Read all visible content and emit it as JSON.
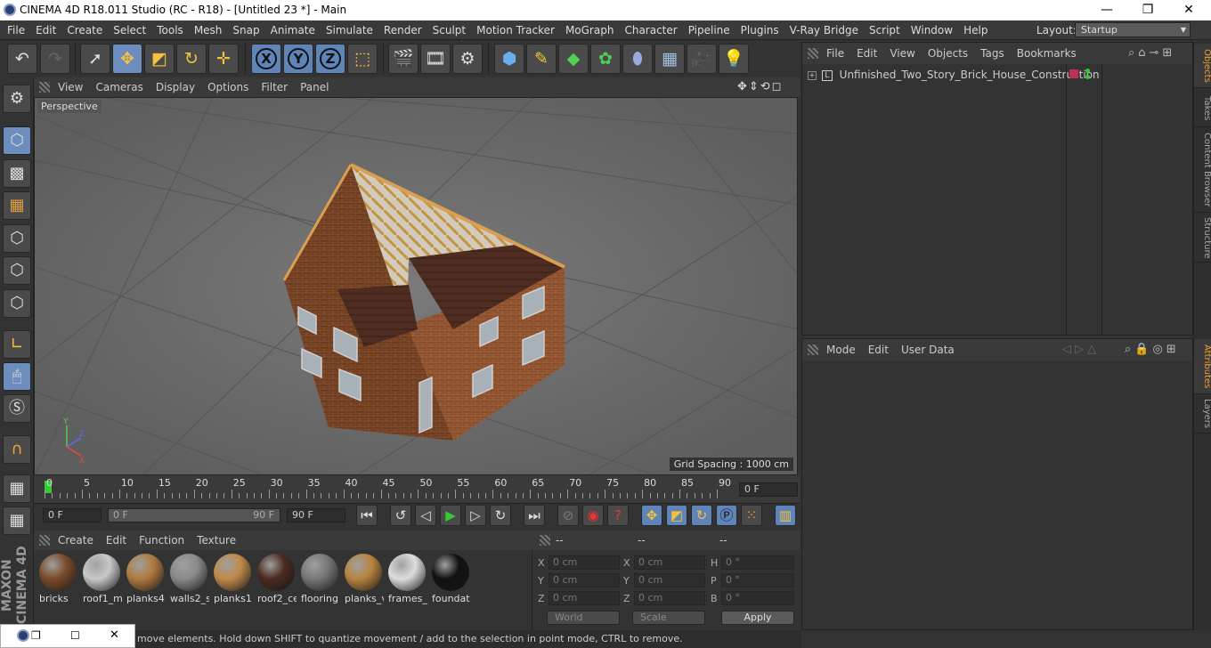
{
  "window": {
    "title": "CINEMA 4D R18.011 Studio (RC - R18) - [Untitled 23 *] - Main",
    "minimize": "—",
    "maximize": "❐",
    "close": "✕"
  },
  "menubar": [
    "File",
    "Edit",
    "Create",
    "Select",
    "Tools",
    "Mesh",
    "Snap",
    "Animate",
    "Simulate",
    "Render",
    "Sculpt",
    "Motion Tracker",
    "MoGraph",
    "Character",
    "Pipeline",
    "Plugins",
    "V-Ray Bridge",
    "Script",
    "Window",
    "Help"
  ],
  "layout": {
    "label": "Layout:",
    "value": "Startup"
  },
  "toolbar": {
    "axis_x": "X",
    "axis_y": "Y",
    "axis_z": "Z"
  },
  "viewport": {
    "menu": [
      "View",
      "Cameras",
      "Display",
      "Options",
      "Filter",
      "Panel"
    ],
    "label": "Perspective",
    "grid_spacing": "Grid Spacing : 1000 cm"
  },
  "timeline": {
    "ticks": [
      "0",
      "5",
      "10",
      "15",
      "20",
      "25",
      "30",
      "35",
      "40",
      "45",
      "50",
      "55",
      "60",
      "65",
      "70",
      "75",
      "80",
      "85",
      "90"
    ],
    "current_frame": "0 F",
    "start_frame": "0 F",
    "range_start": "0 F",
    "range_end": "90 F",
    "end_frame": "90 F"
  },
  "materials": {
    "menu": [
      "Create",
      "Edit",
      "Function",
      "Texture"
    ],
    "items": [
      {
        "label": "bricks",
        "color": "#7a4a2a"
      },
      {
        "label": "roof1_m",
        "color": "#c8c8c8"
      },
      {
        "label": "planks4",
        "color": "#b07a40"
      },
      {
        "label": "walls2_s",
        "color": "#8a8a8a"
      },
      {
        "label": "planks1",
        "color": "#c08a48"
      },
      {
        "label": "roof2_ce",
        "color": "#4a2a20"
      },
      {
        "label": "flooring",
        "color": "#777777"
      },
      {
        "label": "planks_v",
        "color": "#b8843e"
      },
      {
        "label": "frames_v",
        "color": "#dddddd"
      },
      {
        "label": "foundat",
        "color": "#111111"
      }
    ]
  },
  "coordinates": {
    "headers": [
      "--",
      "--",
      "--"
    ],
    "rows": [
      {
        "l1": "X",
        "v1": "0 cm",
        "l2": "X",
        "v2": "0 cm",
        "l3": "H",
        "v3": "0 °"
      },
      {
        "l1": "Y",
        "v1": "0 cm",
        "l2": "Y",
        "v2": "0 cm",
        "l3": "P",
        "v3": "0 °"
      },
      {
        "l1": "Z",
        "v1": "0 cm",
        "l2": "Z",
        "v2": "0 cm",
        "l3": "B",
        "v3": "0 °"
      }
    ],
    "mode1": "World",
    "mode2": "Scale",
    "apply": "Apply"
  },
  "objects": {
    "menu": [
      "File",
      "Edit",
      "View",
      "Objects",
      "Tags",
      "Bookmarks"
    ],
    "items": [
      {
        "name": "Unfinished_Two_Story_Brick_House_Construction"
      }
    ]
  },
  "attributes": {
    "menu": [
      "Mode",
      "Edit",
      "User Data"
    ]
  },
  "side_tabs": [
    "Objects",
    "Takes",
    "Content Browser",
    "Structure",
    "Attributes",
    "Layers"
  ],
  "status": "move elements. Hold down SHIFT to quantize movement / add to the selection in point mode, CTRL to remove.",
  "branding": "MAXON CINEMA 4D",
  "colors": {
    "accent": "#6c8dbd",
    "active_tab": "#f0a030"
  }
}
